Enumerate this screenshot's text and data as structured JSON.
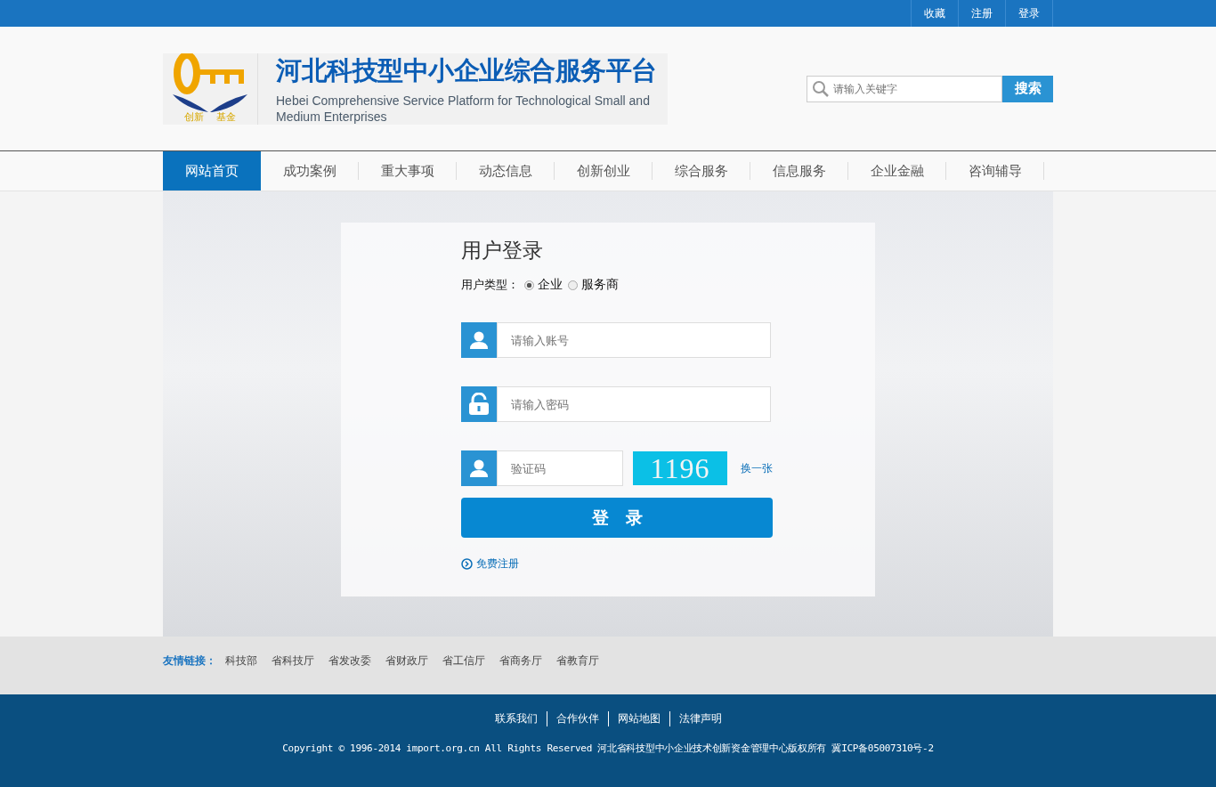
{
  "top_links": [
    "收藏",
    "注册",
    "登录"
  ],
  "logo": {
    "caption_left": "创新",
    "caption_right": "基金"
  },
  "site_title": "河北科技型中小企业综合服务平台",
  "site_subtitle": "Hebei Comprehensive Service Platform for Technological Small and Medium Enterprises",
  "search": {
    "placeholder": "请输入关键字",
    "button": "搜索"
  },
  "nav": [
    {
      "label": "网站首页",
      "selected": true
    },
    {
      "label": "成功案例",
      "selected": false
    },
    {
      "label": "重大事项",
      "selected": false
    },
    {
      "label": "动态信息",
      "selected": false
    },
    {
      "label": "创新创业",
      "selected": false
    },
    {
      "label": "综合服务",
      "selected": false
    },
    {
      "label": "信息服务",
      "selected": false
    },
    {
      "label": "企业金融",
      "selected": false
    },
    {
      "label": "咨询辅导",
      "selected": false
    }
  ],
  "login": {
    "title": "用户登录",
    "user_type_label": "用户类型：",
    "user_types": [
      {
        "label": "企业",
        "selected": true
      },
      {
        "label": "服务商",
        "selected": false
      }
    ],
    "account": {
      "placeholder": "请输入账号"
    },
    "password": {
      "placeholder": "请输入密码"
    },
    "captcha": {
      "placeholder": "验证码",
      "code": "1196",
      "refresh": "换一张"
    },
    "submit": "登　录",
    "register": "免费注册"
  },
  "friend_links": {
    "label": "友情链接：",
    "items": [
      "科技部",
      "省科技厅",
      "省发改委",
      "省财政厅",
      "省工信厅",
      "省商务厅",
      "省教育厅"
    ]
  },
  "footer": {
    "links": [
      "联系我们",
      "合作伙伴",
      "网站地图",
      "法律声明"
    ],
    "copyright": "Copyright © 1996-2014 import.org.cn All Rights Reserved 河北省科技型中小企业技术创新资金管理中心版权所有 冀ICP备05007310号-2"
  }
}
